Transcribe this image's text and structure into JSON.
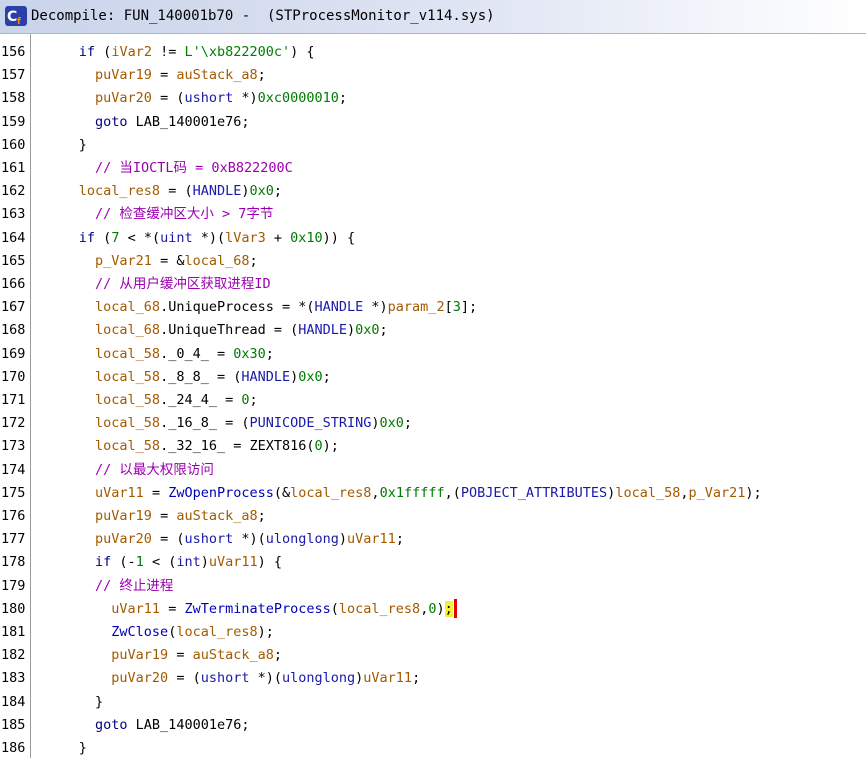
{
  "window": {
    "title": "Decompile: FUN_140001b70 -  (STProcessMonitor_v114.sys)",
    "icon": "decompiler-icon"
  },
  "colors": {
    "keyword": "#000080",
    "variable": "#a35a00",
    "function": "#0000b8",
    "number": "#007a00",
    "comment": "#9b00b0",
    "type": "#1a1aa8"
  },
  "lines": [
    {
      "n": "156",
      "tokens": [
        [
          "plain",
          "      "
        ],
        [
          "kw",
          "if"
        ],
        [
          "plain",
          " ("
        ],
        [
          "var",
          "iVar2"
        ],
        [
          "plain",
          " != "
        ],
        [
          "str",
          "L'\\xb822200c'"
        ],
        [
          "plain",
          ") {"
        ]
      ]
    },
    {
      "n": "157",
      "tokens": [
        [
          "plain",
          "        "
        ],
        [
          "var",
          "puVar19"
        ],
        [
          "plain",
          " = "
        ],
        [
          "var",
          "auStack_a8"
        ],
        [
          "plain",
          ";"
        ]
      ]
    },
    {
      "n": "158",
      "tokens": [
        [
          "plain",
          "        "
        ],
        [
          "var",
          "puVar20"
        ],
        [
          "plain",
          " = ("
        ],
        [
          "ty",
          "ushort"
        ],
        [
          "plain",
          " *)"
        ],
        [
          "num",
          "0xc0000010"
        ],
        [
          "plain",
          ";"
        ]
      ]
    },
    {
      "n": "159",
      "tokens": [
        [
          "plain",
          "        "
        ],
        [
          "kw",
          "goto"
        ],
        [
          "plain",
          " LAB_140001e76;"
        ]
      ]
    },
    {
      "n": "160",
      "tokens": [
        [
          "plain",
          "      }"
        ]
      ]
    },
    {
      "n": "161",
      "tokens": [
        [
          "plain",
          "        "
        ],
        [
          "cm",
          "// 当IOCTL码 = 0xB822200C"
        ]
      ]
    },
    {
      "n": "162",
      "tokens": [
        [
          "plain",
          "      "
        ],
        [
          "var",
          "local_res8"
        ],
        [
          "plain",
          " = ("
        ],
        [
          "ty",
          "HANDLE"
        ],
        [
          "plain",
          ")"
        ],
        [
          "num",
          "0x0"
        ],
        [
          "plain",
          ";"
        ]
      ]
    },
    {
      "n": "163",
      "tokens": [
        [
          "plain",
          "        "
        ],
        [
          "cm",
          "// 检查缓冲区大小 > 7字节"
        ]
      ]
    },
    {
      "n": "164",
      "tokens": [
        [
          "plain",
          "      "
        ],
        [
          "kw",
          "if"
        ],
        [
          "plain",
          " ("
        ],
        [
          "num",
          "7"
        ],
        [
          "plain",
          " < *("
        ],
        [
          "ty",
          "uint"
        ],
        [
          "plain",
          " *)("
        ],
        [
          "var",
          "lVar3"
        ],
        [
          "plain",
          " + "
        ],
        [
          "num",
          "0x10"
        ],
        [
          "plain",
          ")) {"
        ]
      ]
    },
    {
      "n": "165",
      "tokens": [
        [
          "plain",
          "        "
        ],
        [
          "var",
          "p_Var21"
        ],
        [
          "plain",
          " = &"
        ],
        [
          "var",
          "local_68"
        ],
        [
          "plain",
          ";"
        ]
      ]
    },
    {
      "n": "166",
      "tokens": [
        [
          "plain",
          "        "
        ],
        [
          "cm",
          "// 从用户缓冲区获取进程ID"
        ]
      ]
    },
    {
      "n": "167",
      "tokens": [
        [
          "plain",
          "        "
        ],
        [
          "var",
          "local_68"
        ],
        [
          "plain",
          ".UniqueProcess = *("
        ],
        [
          "ty",
          "HANDLE"
        ],
        [
          "plain",
          " *)"
        ],
        [
          "var",
          "param_2"
        ],
        [
          "plain",
          "["
        ],
        [
          "num",
          "3"
        ],
        [
          "plain",
          "];"
        ]
      ]
    },
    {
      "n": "168",
      "tokens": [
        [
          "plain",
          "        "
        ],
        [
          "var",
          "local_68"
        ],
        [
          "plain",
          ".UniqueThread = ("
        ],
        [
          "ty",
          "HANDLE"
        ],
        [
          "plain",
          ")"
        ],
        [
          "num",
          "0x0"
        ],
        [
          "plain",
          ";"
        ]
      ]
    },
    {
      "n": "169",
      "tokens": [
        [
          "plain",
          "        "
        ],
        [
          "var",
          "local_58"
        ],
        [
          "plain",
          "._0_4_ = "
        ],
        [
          "num",
          "0x30"
        ],
        [
          "plain",
          ";"
        ]
      ]
    },
    {
      "n": "170",
      "tokens": [
        [
          "plain",
          "        "
        ],
        [
          "var",
          "local_58"
        ],
        [
          "plain",
          "._8_8_ = ("
        ],
        [
          "ty",
          "HANDLE"
        ],
        [
          "plain",
          ")"
        ],
        [
          "num",
          "0x0"
        ],
        [
          "plain",
          ";"
        ]
      ]
    },
    {
      "n": "171",
      "tokens": [
        [
          "plain",
          "        "
        ],
        [
          "var",
          "local_58"
        ],
        [
          "plain",
          "._24_4_ = "
        ],
        [
          "num",
          "0"
        ],
        [
          "plain",
          ";"
        ]
      ]
    },
    {
      "n": "172",
      "tokens": [
        [
          "plain",
          "        "
        ],
        [
          "var",
          "local_58"
        ],
        [
          "plain",
          "._16_8_ = ("
        ],
        [
          "ty",
          "PUNICODE_STRING"
        ],
        [
          "plain",
          ")"
        ],
        [
          "num",
          "0x0"
        ],
        [
          "plain",
          ";"
        ]
      ]
    },
    {
      "n": "173",
      "tokens": [
        [
          "plain",
          "        "
        ],
        [
          "var",
          "local_58"
        ],
        [
          "plain",
          "._32_16_ = ZEXT816("
        ],
        [
          "num",
          "0"
        ],
        [
          "plain",
          ");"
        ]
      ]
    },
    {
      "n": "174",
      "tokens": [
        [
          "plain",
          "        "
        ],
        [
          "cm",
          "// 以最大权限访问"
        ]
      ]
    },
    {
      "n": "175",
      "tokens": [
        [
          "plain",
          "        "
        ],
        [
          "var",
          "uVar11"
        ],
        [
          "plain",
          " = "
        ],
        [
          "fn",
          "ZwOpenProcess"
        ],
        [
          "plain",
          "(&"
        ],
        [
          "var",
          "local_res8"
        ],
        [
          "plain",
          ","
        ],
        [
          "num",
          "0x1fffff"
        ],
        [
          "plain",
          ",("
        ],
        [
          "ty",
          "POBJECT_ATTRIBUTES"
        ],
        [
          "plain",
          ")"
        ],
        [
          "var",
          "local_58"
        ],
        [
          "plain",
          ","
        ],
        [
          "var",
          "p_Var21"
        ],
        [
          "plain",
          ");"
        ]
      ]
    },
    {
      "n": "176",
      "tokens": [
        [
          "plain",
          "        "
        ],
        [
          "var",
          "puVar19"
        ],
        [
          "plain",
          " = "
        ],
        [
          "var",
          "auStack_a8"
        ],
        [
          "plain",
          ";"
        ]
      ]
    },
    {
      "n": "177",
      "tokens": [
        [
          "plain",
          "        "
        ],
        [
          "var",
          "puVar20"
        ],
        [
          "plain",
          " = ("
        ],
        [
          "ty",
          "ushort"
        ],
        [
          "plain",
          " *)("
        ],
        [
          "ty",
          "ulonglong"
        ],
        [
          "plain",
          ")"
        ],
        [
          "var",
          "uVar11"
        ],
        [
          "plain",
          ";"
        ]
      ]
    },
    {
      "n": "178",
      "tokens": [
        [
          "plain",
          "        "
        ],
        [
          "kw",
          "if"
        ],
        [
          "plain",
          " (-"
        ],
        [
          "num",
          "1"
        ],
        [
          "plain",
          " < ("
        ],
        [
          "ty",
          "int"
        ],
        [
          "plain",
          ")"
        ],
        [
          "var",
          "uVar11"
        ],
        [
          "plain",
          ") {"
        ]
      ]
    },
    {
      "n": "179",
      "tokens": [
        [
          "plain",
          "        "
        ],
        [
          "cm",
          "// 终止进程"
        ]
      ]
    },
    {
      "n": "180",
      "tokens": [
        [
          "plain",
          "          "
        ],
        [
          "var",
          "uVar11"
        ],
        [
          "plain",
          " = "
        ],
        [
          "fn",
          "ZwTerminateProcess"
        ],
        [
          "plain",
          "("
        ],
        [
          "var",
          "local_res8"
        ],
        [
          "plain",
          ","
        ],
        [
          "num",
          "0"
        ],
        [
          "plain",
          ")"
        ],
        [
          "hl",
          ";"
        ],
        [
          "cursor",
          ""
        ]
      ]
    },
    {
      "n": "181",
      "tokens": [
        [
          "plain",
          "          "
        ],
        [
          "fn",
          "ZwClose"
        ],
        [
          "plain",
          "("
        ],
        [
          "var",
          "local_res8"
        ],
        [
          "plain",
          ");"
        ]
      ]
    },
    {
      "n": "182",
      "tokens": [
        [
          "plain",
          "          "
        ],
        [
          "var",
          "puVar19"
        ],
        [
          "plain",
          " = "
        ],
        [
          "var",
          "auStack_a8"
        ],
        [
          "plain",
          ";"
        ]
      ]
    },
    {
      "n": "183",
      "tokens": [
        [
          "plain",
          "          "
        ],
        [
          "var",
          "puVar20"
        ],
        [
          "plain",
          " = ("
        ],
        [
          "ty",
          "ushort"
        ],
        [
          "plain",
          " *)("
        ],
        [
          "ty",
          "ulonglong"
        ],
        [
          "plain",
          ")"
        ],
        [
          "var",
          "uVar11"
        ],
        [
          "plain",
          ";"
        ]
      ]
    },
    {
      "n": "184",
      "tokens": [
        [
          "plain",
          "        }"
        ]
      ]
    },
    {
      "n": "185",
      "tokens": [
        [
          "plain",
          "        "
        ],
        [
          "kw",
          "goto"
        ],
        [
          "plain",
          " LAB_140001e76;"
        ]
      ]
    },
    {
      "n": "186",
      "tokens": [
        [
          "plain",
          "      }"
        ]
      ]
    }
  ]
}
